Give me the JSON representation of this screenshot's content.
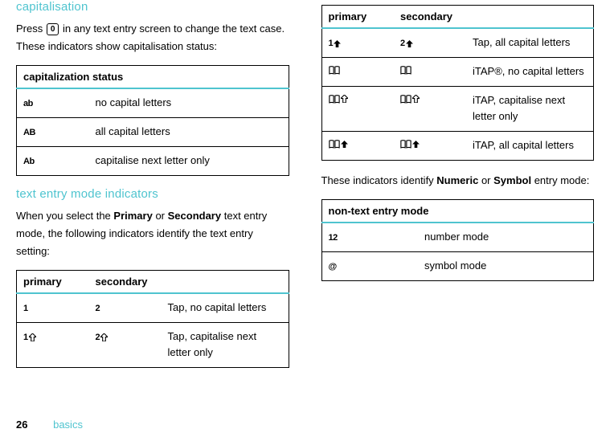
{
  "left": {
    "h_cap": "capitalisation",
    "p_cap_1a": "Press ",
    "p_cap_key": "0",
    "p_cap_1b": " in any text entry screen to change the text case. These indicators show capitalisation status:",
    "tbl_cap_header": "capitalization status",
    "tbl_cap_rows": [
      {
        "icon": "ab",
        "desc": "no capital letters"
      },
      {
        "icon": "AB",
        "desc": "all capital letters"
      },
      {
        "icon": "Ab",
        "desc": "capitalise next letter only"
      }
    ],
    "h_mode": "text entry mode indicators",
    "p_mode_a": "When you select the ",
    "p_mode_primary": "Primary",
    "p_mode_b": " or ",
    "p_mode_secondary": "Secondary",
    "p_mode_c": " text entry mode, the following indicators identify the text entry setting:",
    "tbl_mode_h1": "primary",
    "tbl_mode_h2": "secondary",
    "tbl_mode_rows_l": [
      {
        "p": "1",
        "s": "2",
        "arrow": "none",
        "desc": "Tap, no capital letters"
      },
      {
        "p": "1",
        "s": "2",
        "arrow": "outline",
        "desc": "Tap, capitalise next letter only"
      }
    ]
  },
  "right": {
    "tbl_mode_h1": "primary",
    "tbl_mode_h2": "secondary",
    "tbl_mode_rows_r": [
      {
        "p": "1",
        "s": "2",
        "kind": "num-solid",
        "desc": "Tap, all capital letters"
      },
      {
        "p": "",
        "s": "",
        "kind": "book",
        "desc": "iTAP®, no capital letters"
      },
      {
        "p": "",
        "s": "",
        "kind": "book-outline",
        "desc": "iTAP, capitalise next letter only"
      },
      {
        "p": "",
        "s": "",
        "kind": "book-solid",
        "desc": "iTAP, all capital letters"
      }
    ],
    "p_nontext_a": "These indicators identify ",
    "p_nontext_num": "Numeric",
    "p_nontext_b": " or ",
    "p_nontext_sym": "Symbol",
    "p_nontext_c": " entry mode:",
    "tbl_non_header": "non-text entry mode",
    "tbl_non_rows": [
      {
        "icon": "12",
        "desc": "number mode"
      },
      {
        "icon": "@",
        "desc": "symbol mode"
      }
    ]
  },
  "footer": {
    "page": "26",
    "section": "basics"
  }
}
